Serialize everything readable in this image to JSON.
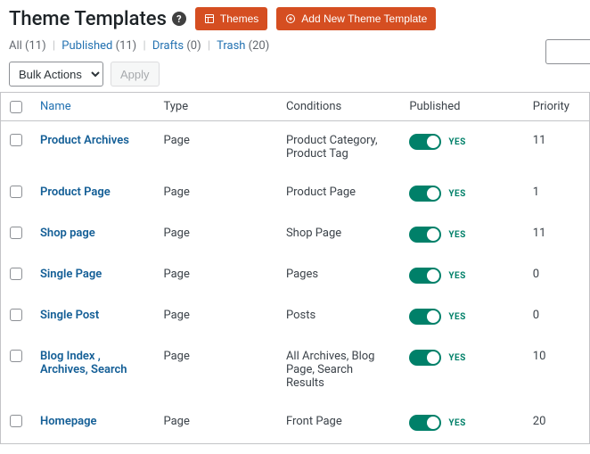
{
  "header": {
    "title": "Theme Templates",
    "themes_btn": "Themes",
    "add_btn": "Add New Theme Template"
  },
  "filters": {
    "all_label": "All",
    "all_count": "(11)",
    "published_label": "Published",
    "published_count": "(11)",
    "drafts_label": "Drafts",
    "drafts_count": "(0)",
    "trash_label": "Trash",
    "trash_count": "(20)"
  },
  "bulk": {
    "select_label": "Bulk Actions",
    "apply_label": "Apply"
  },
  "columns": {
    "name": "Name",
    "type": "Type",
    "conditions": "Conditions",
    "published": "Published",
    "priority": "Priority"
  },
  "toggle_yes": "YES",
  "rows": [
    {
      "name": "Product Archives",
      "type": "Page",
      "conditions": "Product Category, Product Tag",
      "priority": "11"
    },
    {
      "name": "Product Page",
      "type": "Page",
      "conditions": "Product Page",
      "priority": "1"
    },
    {
      "name": "Shop page",
      "type": "Page",
      "conditions": "Shop Page",
      "priority": "11"
    },
    {
      "name": "Single Page",
      "type": "Page",
      "conditions": "Pages",
      "priority": "0"
    },
    {
      "name": "Single Post",
      "type": "Page",
      "conditions": "Posts",
      "priority": "0"
    },
    {
      "name": "Blog Index , Archives, Search",
      "type": "Page",
      "conditions": "All Archives, Blog Page, Search Results",
      "priority": "10"
    },
    {
      "name": "Homepage",
      "type": "Page",
      "conditions": "Front Page",
      "priority": "20"
    }
  ]
}
